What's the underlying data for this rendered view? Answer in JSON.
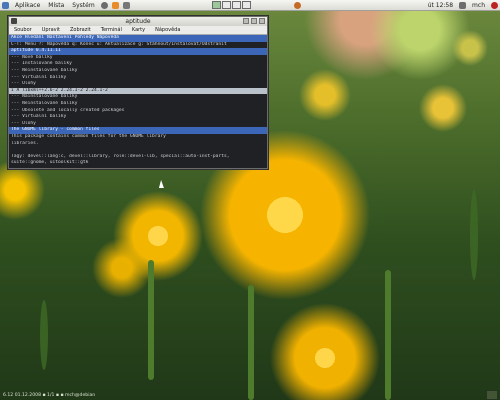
{
  "top_panel": {
    "menus": [
      "Aplikace",
      "Místa",
      "Systém"
    ],
    "clock": "út 12:58",
    "user": "mch"
  },
  "window": {
    "title": "aptitude",
    "menubar": [
      "Soubor",
      "Upravit",
      "Zobrazit",
      "Terminál",
      "Karty",
      "Nápověda"
    ]
  },
  "terminal": {
    "lines": [
      "Akce  Hledání  Nastavení  Pohledy  Nápověda",
      "C-T: Menu  ?: Nápověda  q: Konec  u: Aktualizace  g: Stáhnout/Instalovat/Odstranit",
      "aptitude 0.4.11.11",
      "--- Nové balíky",
      "--- Instalované balíky",
      "--- Neinstalované balíky",
      "--- Virtuální balíky",
      "--- Úlohy",
      "i A  libxml++2.6-2                          2.24.1-2    2.24.1-2",
      "--- Nainstalované balíky",
      "--- Neinstalované balíky",
      "--- Obsolete and locally created packages",
      "--- Virtuální balíky",
      "--- Úlohy",
      "The GNOME library - common files",
      "This package contains common files for the GNOME library",
      "libraries.",
      "",
      "Tagy: devel::lang:c, devel::library, role::devel-lib, special::auto-inst-parts,",
      "      suite::gnome, uitoolkit::gtk"
    ]
  },
  "bottom": {
    "text": "6.12  01.12.2008  ▪ 1/1  ▪ ▪  mch@debian",
    "tray_label": ""
  }
}
